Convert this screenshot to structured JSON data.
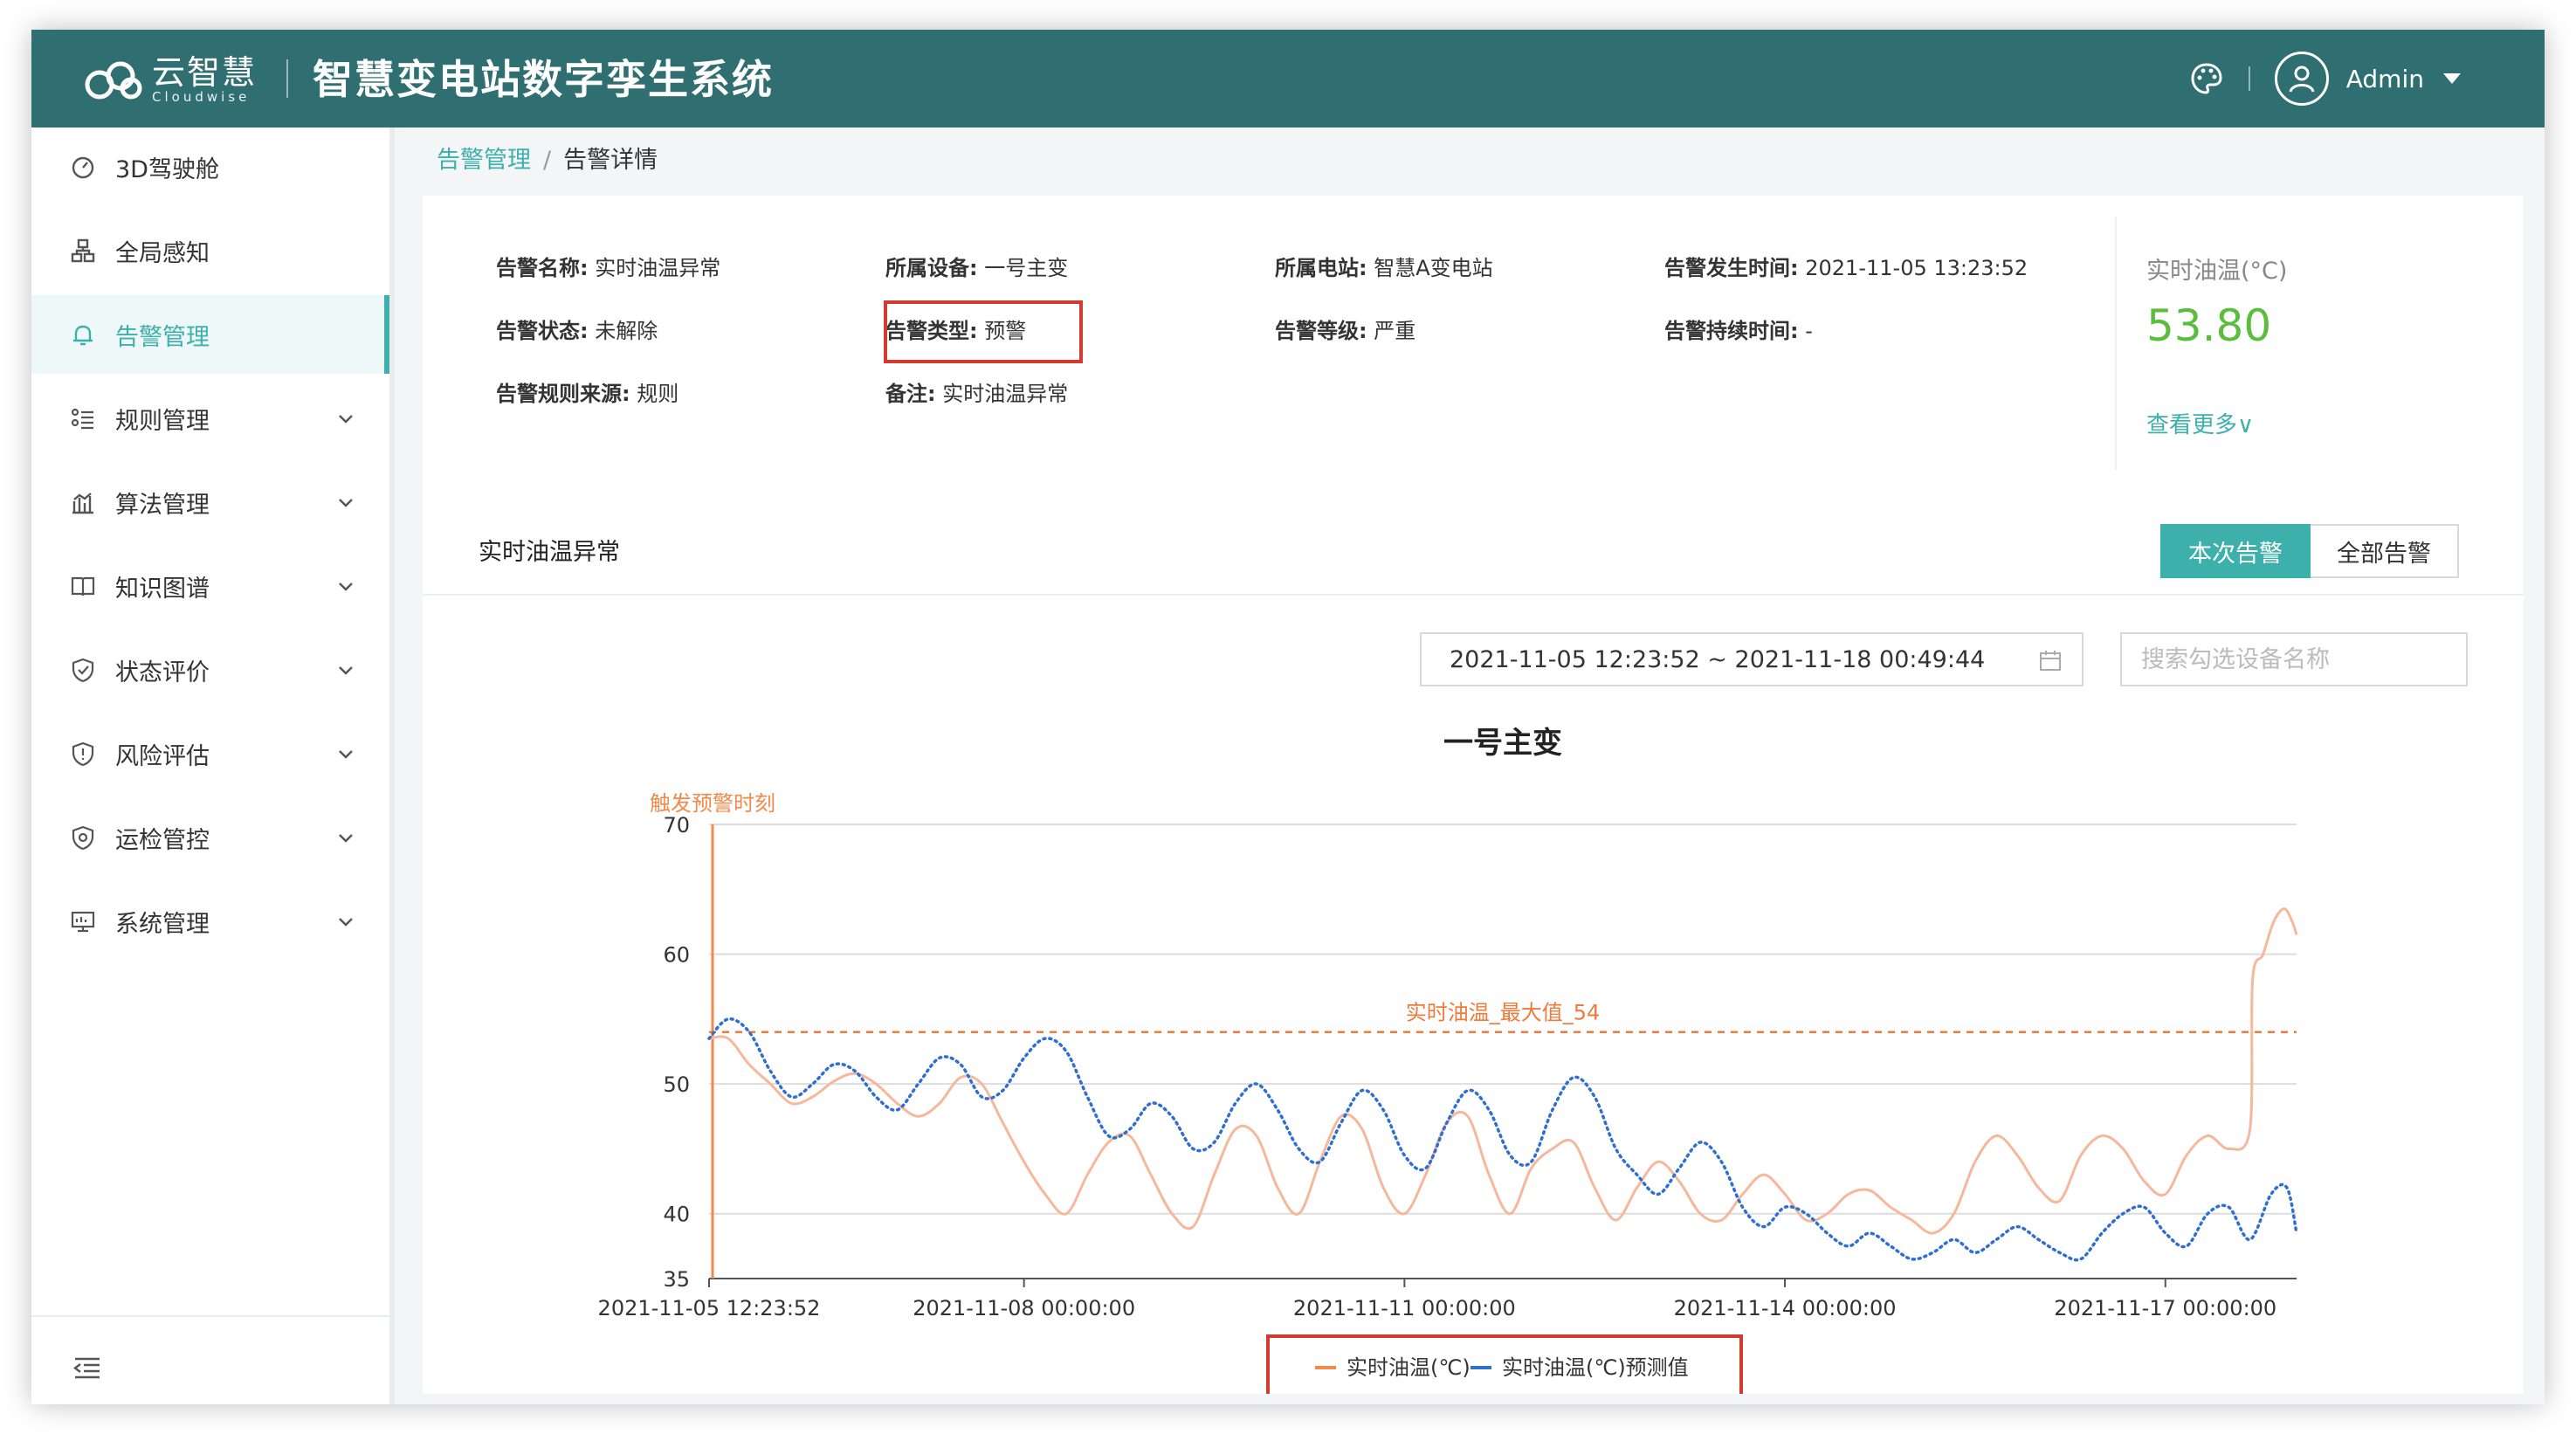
{
  "header": {
    "logo_cn": "云智慧",
    "logo_en": "Cloudwise",
    "system_title": "智慧变电站数字孪生系统",
    "user_name": "Admin"
  },
  "sidebar": {
    "items": [
      {
        "label": "3D驾驶舱",
        "icon": "dashboard-icon",
        "has_children": false,
        "active": false
      },
      {
        "label": "全局感知",
        "icon": "network-icon",
        "has_children": false,
        "active": false
      },
      {
        "label": "告警管理",
        "icon": "bell-icon",
        "has_children": false,
        "active": true
      },
      {
        "label": "规则管理",
        "icon": "list-icon",
        "has_children": true,
        "active": false
      },
      {
        "label": "算法管理",
        "icon": "bar-chart-icon",
        "has_children": true,
        "active": false
      },
      {
        "label": "知识图谱",
        "icon": "book-icon",
        "has_children": true,
        "active": false
      },
      {
        "label": "状态评价",
        "icon": "shield-icon",
        "has_children": true,
        "active": false
      },
      {
        "label": "风险评估",
        "icon": "shield-alert-icon",
        "has_children": true,
        "active": false
      },
      {
        "label": "运检管控",
        "icon": "gear-shield-icon",
        "has_children": true,
        "active": false
      },
      {
        "label": "系统管理",
        "icon": "monitor-icon",
        "has_children": true,
        "active": false
      }
    ]
  },
  "breadcrumb": {
    "parent": "告警管理",
    "separator": "/",
    "current": "告警详情"
  },
  "alarm": {
    "name_label": "告警名称:",
    "name": "实时油温异常",
    "device_label": "所属设备:",
    "device": "一号主变",
    "station_label": "所属电站:",
    "station": "智慧A变电站",
    "time_label": "告警发生时间:",
    "time": "2021-11-05 13:23:52",
    "status_label": "告警状态:",
    "status": "未解除",
    "type_label": "告警类型:",
    "type": "预警",
    "level_label": "告警等级:",
    "level": "严重",
    "duration_label": "告警持续时间:",
    "duration": "-",
    "source_label": "告警规则来源:",
    "source": "规则",
    "remark_label": "备注:",
    "remark": "实时油温异常"
  },
  "realtime": {
    "label": "实时油温(°C)",
    "value": "53.80",
    "more": "查看更多∨",
    "value_color": "#5bbd3b"
  },
  "chart_panel": {
    "title": "实时油温异常",
    "btn_current": "本次告警",
    "btn_all": "全部告警",
    "date_range": "2021-11-05 12:23:52 ~ 2021-11-18 00:49:44",
    "search_placeholder": "搜索勾选设备名称"
  },
  "colors": {
    "header": "#2f6f72",
    "accent": "#3db0ac",
    "actual": "#f08a4b",
    "predicted": "#2f6fd0",
    "highlight": "#d63a2f"
  },
  "chart_data": {
    "type": "line",
    "title": "一号主变",
    "x_start": "2021-11-05 12:23:52",
    "x_end": "2021-11-18 00:49:44",
    "xticks": [
      "2021-11-05 12:23:52",
      "2021-11-08 00:00:00",
      "2021-11-11 00:00:00",
      "2021-11-14 00:00:00",
      "2021-11-17 00:00:00"
    ],
    "yticks": [
      35,
      40,
      50,
      60,
      70
    ],
    "ylim": [
      35,
      70
    ],
    "grid": true,
    "legend": "bottom-center",
    "trigger_label": "触发预警时刻",
    "trigger_time": "2021-11-05 12:23:52",
    "max_line": {
      "label": "实时油温_最大值_54",
      "value": 54
    },
    "series": [
      {
        "name": "实时油温(℃)",
        "style": "solid",
        "points": [
          [
            "2021-11-05 12:23:52",
            53.5
          ],
          [
            "2021-11-05 16:00:00",
            53.5
          ],
          [
            "2021-11-05 20:00:00",
            51.5
          ],
          [
            "2021-11-06 00:00:00",
            50
          ],
          [
            "2021-11-06 04:00:00",
            48.5
          ],
          [
            "2021-11-06 08:00:00",
            49
          ],
          [
            "2021-11-06 12:00:00",
            50.2
          ],
          [
            "2021-11-06 16:00:00",
            50.8
          ],
          [
            "2021-11-06 20:00:00",
            50
          ],
          [
            "2021-11-07 00:00:00",
            48.5
          ],
          [
            "2021-11-07 04:00:00",
            47.5
          ],
          [
            "2021-11-07 08:00:00",
            48.5
          ],
          [
            "2021-11-07 12:00:00",
            50.5
          ],
          [
            "2021-11-07 16:00:00",
            50
          ],
          [
            "2021-11-07 20:00:00",
            47
          ],
          [
            "2021-11-08 00:00:00",
            44
          ],
          [
            "2021-11-08 04:00:00",
            41.5
          ],
          [
            "2021-11-08 08:00:00",
            40
          ],
          [
            "2021-11-08 12:00:00",
            43
          ],
          [
            "2021-11-08 16:00:00",
            45.5
          ],
          [
            "2021-11-08 20:00:00",
            46
          ],
          [
            "2021-11-09 00:00:00",
            43
          ],
          [
            "2021-11-09 04:00:00",
            40
          ],
          [
            "2021-11-09 08:00:00",
            39
          ],
          [
            "2021-11-09 12:00:00",
            43
          ],
          [
            "2021-11-09 16:00:00",
            46.5
          ],
          [
            "2021-11-09 20:00:00",
            46
          ],
          [
            "2021-11-10 00:00:00",
            42
          ],
          [
            "2021-11-10 04:00:00",
            40
          ],
          [
            "2021-11-10 08:00:00",
            44
          ],
          [
            "2021-11-10 12:00:00",
            47.5
          ],
          [
            "2021-11-10 16:00:00",
            46.5
          ],
          [
            "2021-11-10 20:00:00",
            42
          ],
          [
            "2021-11-11 00:00:00",
            40
          ],
          [
            "2021-11-11 04:00:00",
            43
          ],
          [
            "2021-11-11 08:00:00",
            47
          ],
          [
            "2021-11-11 12:00:00",
            47.5
          ],
          [
            "2021-11-11 16:00:00",
            43
          ],
          [
            "2021-11-11 20:00:00",
            40
          ],
          [
            "2021-11-12 00:00:00",
            43.5
          ],
          [
            "2021-11-12 04:00:00",
            45
          ],
          [
            "2021-11-12 08:00:00",
            45.5
          ],
          [
            "2021-11-12 12:00:00",
            42
          ],
          [
            "2021-11-12 16:00:00",
            39.5
          ],
          [
            "2021-11-12 20:00:00",
            42
          ],
          [
            "2021-11-13 00:00:00",
            44
          ],
          [
            "2021-11-13 04:00:00",
            42.5
          ],
          [
            "2021-11-13 08:00:00",
            40
          ],
          [
            "2021-11-13 12:00:00",
            39.5
          ],
          [
            "2021-11-13 16:00:00",
            41.5
          ],
          [
            "2021-11-13 20:00:00",
            43
          ],
          [
            "2021-11-14 00:00:00",
            41.5
          ],
          [
            "2021-11-14 04:00:00",
            39.5
          ],
          [
            "2021-11-14 08:00:00",
            40
          ],
          [
            "2021-11-14 12:00:00",
            41.5
          ],
          [
            "2021-11-14 16:00:00",
            41.8
          ],
          [
            "2021-11-14 20:00:00",
            40.5
          ],
          [
            "2021-11-15 00:00:00",
            39.5
          ],
          [
            "2021-11-15 04:00:00",
            38.5
          ],
          [
            "2021-11-15 08:00:00",
            40
          ],
          [
            "2021-11-15 12:00:00",
            44
          ],
          [
            "2021-11-15 16:00:00",
            46
          ],
          [
            "2021-11-15 20:00:00",
            44.5
          ],
          [
            "2021-11-16 00:00:00",
            42
          ],
          [
            "2021-11-16 04:00:00",
            41
          ],
          [
            "2021-11-16 08:00:00",
            44.5
          ],
          [
            "2021-11-16 12:00:00",
            46
          ],
          [
            "2021-11-16 16:00:00",
            45
          ],
          [
            "2021-11-16 20:00:00",
            42.5
          ],
          [
            "2021-11-17 00:00:00",
            41.5
          ],
          [
            "2021-11-17 04:00:00",
            44.5
          ],
          [
            "2021-11-17 08:00:00",
            46
          ],
          [
            "2021-11-17 12:00:00",
            45
          ],
          [
            "2021-11-17 16:00:00",
            46.5
          ],
          [
            "2021-11-17 16:30:00",
            58
          ],
          [
            "2021-11-17 18:30:00",
            60
          ],
          [
            "2021-11-17 20:30:00",
            62.5
          ],
          [
            "2021-11-17 22:30:00",
            63.5
          ],
          [
            "2021-11-18 00:00:00",
            62.5
          ],
          [
            "2021-11-18 00:49:44",
            61.5
          ]
        ]
      },
      {
        "name": "实时油温(℃)预测值",
        "style": "dotted",
        "points": [
          [
            "2021-11-05 12:23:52",
            53.5
          ],
          [
            "2021-11-05 16:00:00",
            55
          ],
          [
            "2021-11-05 20:00:00",
            54
          ],
          [
            "2021-11-06 00:00:00",
            51
          ],
          [
            "2021-11-06 04:00:00",
            49
          ],
          [
            "2021-11-06 08:00:00",
            50
          ],
          [
            "2021-11-06 12:00:00",
            51.5
          ],
          [
            "2021-11-06 16:00:00",
            51
          ],
          [
            "2021-11-06 20:00:00",
            49
          ],
          [
            "2021-11-07 00:00:00",
            48
          ],
          [
            "2021-11-07 04:00:00",
            50
          ],
          [
            "2021-11-07 08:00:00",
            52
          ],
          [
            "2021-11-07 12:00:00",
            51.5
          ],
          [
            "2021-11-07 16:00:00",
            49
          ],
          [
            "2021-11-07 20:00:00",
            49.5
          ],
          [
            "2021-11-08 00:00:00",
            52
          ],
          [
            "2021-11-08 04:00:00",
            53.5
          ],
          [
            "2021-11-08 08:00:00",
            52.5
          ],
          [
            "2021-11-08 12:00:00",
            49
          ],
          [
            "2021-11-08 16:00:00",
            46
          ],
          [
            "2021-11-08 20:00:00",
            46.5
          ],
          [
            "2021-11-09 00:00:00",
            48.5
          ],
          [
            "2021-11-09 04:00:00",
            47.5
          ],
          [
            "2021-11-09 08:00:00",
            45
          ],
          [
            "2021-11-09 12:00:00",
            45.5
          ],
          [
            "2021-11-09 16:00:00",
            48.5
          ],
          [
            "2021-11-09 20:00:00",
            50
          ],
          [
            "2021-11-10 00:00:00",
            48
          ],
          [
            "2021-11-10 04:00:00",
            45
          ],
          [
            "2021-11-10 08:00:00",
            44
          ],
          [
            "2021-11-10 12:00:00",
            47
          ],
          [
            "2021-11-10 16:00:00",
            49.5
          ],
          [
            "2021-11-10 20:00:00",
            48
          ],
          [
            "2021-11-11 00:00:00",
            44.5
          ],
          [
            "2021-11-11 04:00:00",
            43.5
          ],
          [
            "2021-11-11 08:00:00",
            47
          ],
          [
            "2021-11-11 12:00:00",
            49.5
          ],
          [
            "2021-11-11 16:00:00",
            48
          ],
          [
            "2021-11-11 20:00:00",
            44.5
          ],
          [
            "2021-11-12 00:00:00",
            44
          ],
          [
            "2021-11-12 04:00:00",
            48
          ],
          [
            "2021-11-12 08:00:00",
            50.5
          ],
          [
            "2021-11-12 12:00:00",
            49
          ],
          [
            "2021-11-12 16:00:00",
            45
          ],
          [
            "2021-11-12 20:00:00",
            43
          ],
          [
            "2021-11-13 00:00:00",
            41.5
          ],
          [
            "2021-11-13 04:00:00",
            43.5
          ],
          [
            "2021-11-13 08:00:00",
            45.5
          ],
          [
            "2021-11-13 12:00:00",
            44
          ],
          [
            "2021-11-13 16:00:00",
            40.5
          ],
          [
            "2021-11-13 20:00:00",
            39
          ],
          [
            "2021-11-14 00:00:00",
            40.5
          ],
          [
            "2021-11-14 04:00:00",
            40
          ],
          [
            "2021-11-14 08:00:00",
            38.5
          ],
          [
            "2021-11-14 12:00:00",
            37.5
          ],
          [
            "2021-11-14 16:00:00",
            38.5
          ],
          [
            "2021-11-14 20:00:00",
            37.5
          ],
          [
            "2021-11-15 00:00:00",
            36.5
          ],
          [
            "2021-11-15 04:00:00",
            37
          ],
          [
            "2021-11-15 08:00:00",
            38
          ],
          [
            "2021-11-15 12:00:00",
            37
          ],
          [
            "2021-11-15 16:00:00",
            38
          ],
          [
            "2021-11-15 20:00:00",
            39
          ],
          [
            "2021-11-16 00:00:00",
            38
          ],
          [
            "2021-11-16 04:00:00",
            37
          ],
          [
            "2021-11-16 08:00:00",
            36.5
          ],
          [
            "2021-11-16 12:00:00",
            38.5
          ],
          [
            "2021-11-16 16:00:00",
            40
          ],
          [
            "2021-11-16 20:00:00",
            40.5
          ],
          [
            "2021-11-17 00:00:00",
            38.5
          ],
          [
            "2021-11-17 04:00:00",
            37.5
          ],
          [
            "2021-11-17 08:00:00",
            40
          ],
          [
            "2021-11-17 12:00:00",
            40.5
          ],
          [
            "2021-11-17 16:00:00",
            38
          ],
          [
            "2021-11-17 20:00:00",
            41.5
          ],
          [
            "2021-11-17 23:00:00",
            42
          ],
          [
            "2021-11-18 00:49:44",
            38.5
          ]
        ]
      }
    ]
  }
}
